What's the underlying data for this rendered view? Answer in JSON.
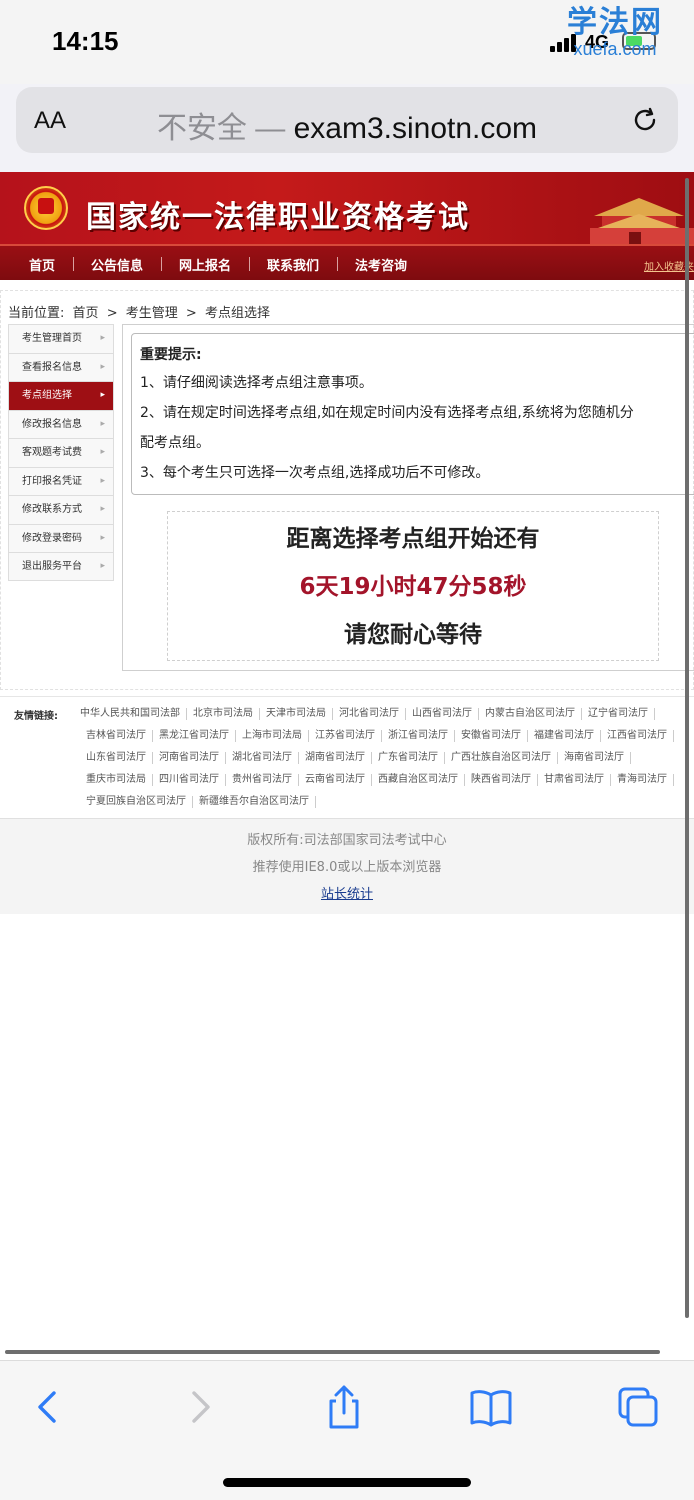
{
  "status": {
    "time": "14:15",
    "network": "4G"
  },
  "watermark": {
    "brand": "学法网",
    "domain": "xuefa.com"
  },
  "browser": {
    "text_size_label": "AA",
    "security": "不安全 — ",
    "domain": "exam3.sinotn.com"
  },
  "site": {
    "title": "国家统一法律职业资格考试",
    "nav": [
      "首页",
      "公告信息",
      "网上报名",
      "联系我们",
      "法考咨询"
    ],
    "favorite": "加入收藏夹"
  },
  "breadcrumb": {
    "label": "当前位置:",
    "items": [
      "首页",
      ">",
      "考生管理",
      ">",
      "考点组选择"
    ]
  },
  "sidebar": {
    "items": [
      "考生管理首页",
      "查看报名信息",
      "考点组选择",
      "修改报名信息",
      "客观题考试费",
      "打印报名凭证",
      "修改联系方式",
      "修改登录密码",
      "退出服务平台"
    ],
    "active_index": 2
  },
  "notice": {
    "heading": "重要提示:",
    "lines": [
      "1、请仔细阅读选择考点组注意事项。",
      "2、请在规定时间选择考点组,如在规定时间内没有选择考点组,系统将为您随机分",
      "配考点组。",
      "3、每个考生只可选择一次考点组,选择成功后不可修改。"
    ]
  },
  "countdown": {
    "title": "距离选择考点组开始还有",
    "remaining": "6天19小时47分58秒",
    "wait": "请您耐心等待"
  },
  "links": {
    "label": "友情链接:",
    "items": [
      "中华人民共和国司法部",
      "北京市司法局",
      "天津市司法局",
      "河北省司法厅",
      "山西省司法厅",
      "内蒙古自治区司法厅",
      "辽宁省司法厅",
      "吉林省司法厅",
      "黑龙江省司法厅",
      "上海市司法局",
      "江苏省司法厅",
      "浙江省司法厅",
      "安徽省司法厅",
      "福建省司法厅",
      "江西省司法厅",
      "山东省司法厅",
      "河南省司法厅",
      "湖北省司法厅",
      "湖南省司法厅",
      "广东省司法厅",
      "广西壮族自治区司法厅",
      "海南省司法厅",
      "重庆市司法局",
      "四川省司法厅",
      "贵州省司法厅",
      "云南省司法厅",
      "西藏自治区司法厅",
      "陕西省司法厅",
      "甘肃省司法厅",
      "青海司法厅",
      "宁夏回族自治区司法厅",
      "新疆维吾尔自治区司法厅"
    ]
  },
  "footer": {
    "copyright": "版权所有:司法部国家司法考试中心",
    "browser_tip": "推荐使用IE8.0或以上版本浏览器",
    "stats": "站长统计"
  },
  "icons": [
    "signal-icon",
    "battery-icon",
    "reload-icon",
    "back-icon",
    "forward-icon",
    "share-icon",
    "bookmarks-icon",
    "tabs-icon",
    "emblem-icon"
  ],
  "colors": {
    "brand_red": "#b5121b",
    "countdown_red": "#a3142a",
    "link_blue": "#1a3c8f",
    "ios_blue": "#2f7cf6"
  }
}
